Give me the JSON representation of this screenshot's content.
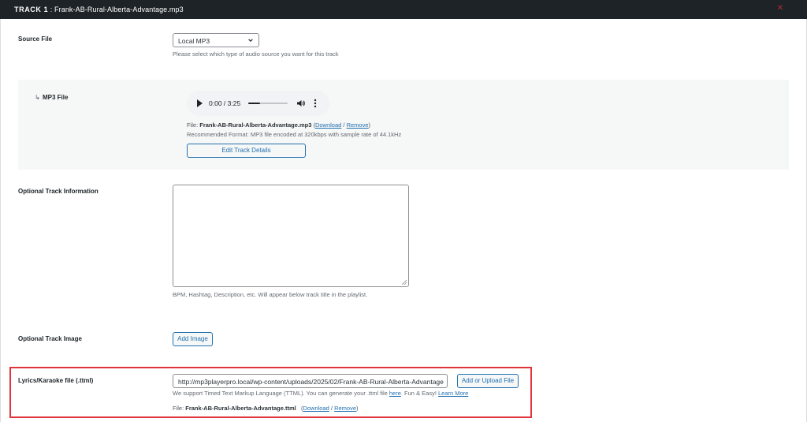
{
  "header": {
    "track_label": "TRACK 1",
    "separator": " : ",
    "track_name": "Frank-AB-Rural-Alberta-Advantage.mp3",
    "close_icon": "close-icon"
  },
  "source_file": {
    "label": "Source File",
    "selected": "Local MP3",
    "help": "Please select which type of audio source you want for this track"
  },
  "mp3_file": {
    "arrow": "↳",
    "label": "MP3 File",
    "player": {
      "time": "0:00 / 3:25",
      "progress_fraction": 0.3
    },
    "file_prefix": "File: ",
    "file_name": "Frank-AB-Rural-Alberta-Advantage.mp3",
    "open_paren": " (",
    "download_label": "Download",
    "slash": " / ",
    "remove_label": "Remove",
    "close_paren": ")",
    "recommended": "Recommended Format: MP3 file encoded at 320kbps with sample rate of 44.1kHz",
    "edit_button": "Edit Track Details"
  },
  "track_info": {
    "label": "Optional Track Information",
    "value": "",
    "help": "BPM, Hashtag, Description, etc. Will appear below track title in the playlist."
  },
  "track_image": {
    "label": "Optional Track Image",
    "button": "Add Image"
  },
  "lyrics": {
    "label": "Lyrics/Karaoke file (.ttml)",
    "url_value": "http://mp3playerpro.local/wp-content/uploads/2025/02/Frank-AB-Rural-Alberta-Advantage",
    "upload_button": "Add or Upload File",
    "help_prefix": "We support Timed Text Markup Language (TTML). You can generate your .ttml file ",
    "help_here": "here",
    "help_mid": ". Fun & Easy! ",
    "help_learn": "Learn More",
    "file_prefix": "File: ",
    "file_name": "Frank-AB-Rural-Alberta-Advantage.ttml",
    "open_paren": "   (",
    "download_label": "Download",
    "slash": " / ",
    "remove_label": "Remove",
    "close_paren": ")"
  },
  "colors": {
    "header_bg": "#1d2327",
    "link": "#2271b1",
    "highlight": "#e0343d",
    "panel_bg": "#f6f7f7"
  }
}
